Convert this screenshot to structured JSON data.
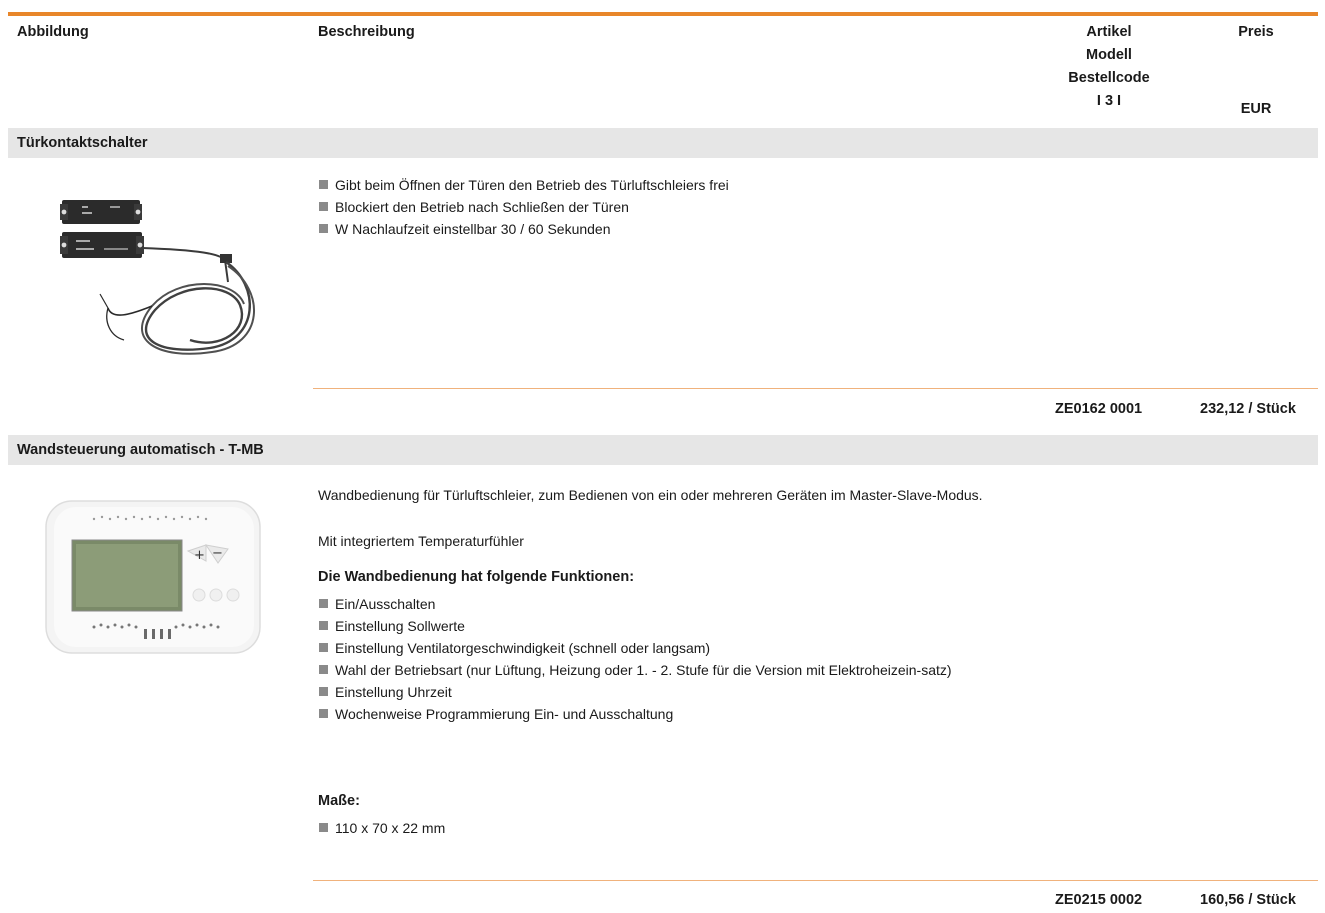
{
  "header": {
    "abbildung": "Abbildung",
    "beschreibung": "Beschreibung",
    "artikel_lines": [
      "Artikel",
      "Modell",
      "Bestellcode",
      "I 3 I"
    ],
    "preis": "Preis",
    "eur": "EUR"
  },
  "colors": {
    "accent": "#e8862a",
    "section_bg": "#e6e6e6",
    "bullet": "#8a8a8a"
  },
  "products": [
    {
      "title": "Türkontaktschalter",
      "image_icon": "door-contact-switch",
      "bullets": [
        "Gibt beim Öffnen der Türen den Betrieb des Türluftschleiers frei",
        "Blockiert den Betrieb nach Schließen der Türen",
        "W Nachlaufzeit einstellbar 30 / 60 Sekunden"
      ],
      "code": "ZE0162 0001",
      "price": "232,12 / Stück"
    },
    {
      "title": "Wandsteuerung automatisch - T-MB",
      "image_icon": "wall-controller",
      "description": "Wandbedienung für Türluftschleier, zum Bedienen von ein oder mehreren Geräten im Master-Slave-Modus.",
      "description2": "Mit integriertem Temperaturfühler",
      "functions_heading": "Die Wandbedienung hat folgende Funktionen:",
      "functions": [
        "Ein/Ausschalten",
        "Einstellung Sollwerte",
        "Einstellung Ventilatorgeschwindigkeit (schnell oder langsam)",
        "Wahl der Betriebsart (nur Lüftung, Heizung oder 1. - 2. Stufe für die Version mit Elektroheizein-satz)",
        "Einstellung Uhrzeit",
        "Wochenweise Programmierung Ein- und Ausschaltung"
      ],
      "dimensions_heading": "Maße:",
      "dimensions": [
        "110 x 70 x 22 mm"
      ],
      "code": "ZE0215 0002",
      "price": "160,56 / Stück"
    }
  ]
}
